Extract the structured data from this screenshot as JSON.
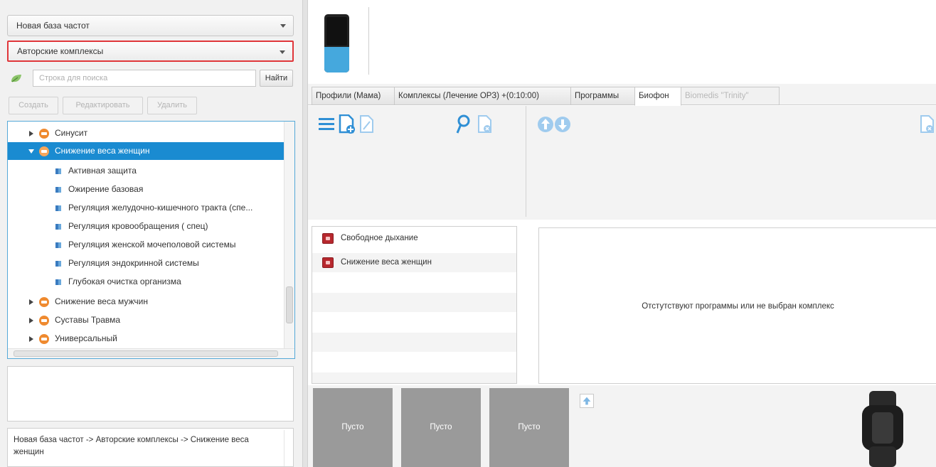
{
  "left": {
    "database_select": "Новая база частот",
    "category_select": "Авторские комплексы",
    "search_placeholder": "Строка для поиска",
    "find_label": "Найти",
    "actions": [
      "Создать",
      "Редактировать",
      "Удалить"
    ],
    "breadcrumb": "Новая база частот -> Авторские комплексы -> Снижение веса женщин"
  },
  "tree": [
    {
      "label": "Синусит"
    },
    {
      "label": "Снижение веса женщин",
      "expanded": true,
      "selected": true,
      "children": [
        "Активная защита",
        "Ожирение базовая",
        "Регуляция желудочно-кишечного тракта (спе...",
        "Регуляция кровообращения ( спец)",
        "Регуляция женской мочеполовой системы",
        "Регуляция эндокринной системы",
        "Глубокая очистка организма"
      ]
    },
    {
      "label": "Снижение веса мужчин"
    },
    {
      "label": "Суставы Травма"
    },
    {
      "label": "Универсальный"
    }
  ],
  "tabs": [
    "Профили (Мама)",
    "Комплексы (Лечение ОРЗ) +(0:10:00)",
    "Программы",
    "Биофон",
    "Biomedis \"Trinity\""
  ],
  "complex_list": [
    "Свободное дыхание",
    "Снижение веса женщин"
  ],
  "program_panel": {
    "message": "Отстутствуют программы или не выбран комплекс"
  },
  "slots": [
    "Пусто",
    "Пусто",
    "Пусто"
  ],
  "colors": {
    "accent": "#1a8bd1",
    "highlight_border": "#e0363a",
    "folder": "#ef8a2f",
    "slot": "#9a9a9a"
  }
}
